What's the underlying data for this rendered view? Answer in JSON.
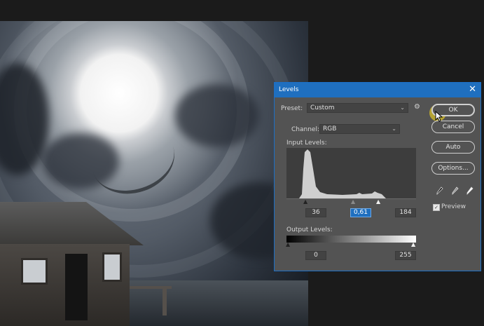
{
  "dialog": {
    "title": "Levels",
    "preset_label": "Preset:",
    "preset_value": "Custom",
    "channel_label": "Channel:",
    "channel_value": "RGB",
    "input_levels_label": "Input Levels:",
    "input_black": "36",
    "input_gamma": "0,61",
    "input_white": "184",
    "output_levels_label": "Output Levels:",
    "output_black": "0",
    "output_white": "255",
    "buttons": {
      "ok": "OK",
      "cancel": "Cancel",
      "auto": "Auto",
      "options": "Options..."
    },
    "preview_label": "Preview",
    "preview_checked": true
  },
  "icons": {
    "close": "close-icon",
    "preset_options": "gear-icon",
    "black_eyedropper": "eyedropper-black-icon",
    "gray_eyedropper": "eyedropper-gray-icon",
    "white_eyedropper": "eyedropper-white-icon"
  },
  "colors": {
    "accent": "#1f6fbf",
    "dialog_bg": "#535353",
    "app_bg": "#1b1b1b"
  }
}
